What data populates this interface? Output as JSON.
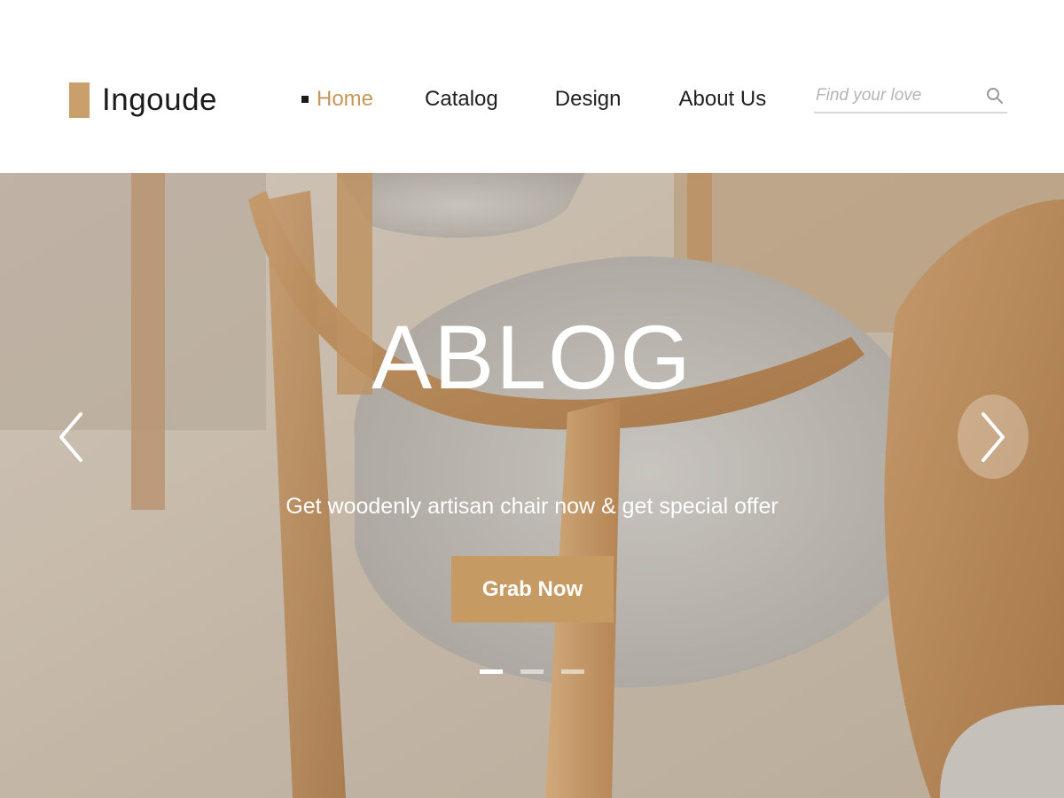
{
  "brand": {
    "name": "Ingoude",
    "accent_color": "#c69a63"
  },
  "nav": {
    "items": [
      {
        "label": "Home",
        "active": true
      },
      {
        "label": "Catalog",
        "active": false
      },
      {
        "label": "Design",
        "active": false
      },
      {
        "label": "About Us",
        "active": false
      }
    ]
  },
  "search": {
    "placeholder": "Find your love",
    "value": "",
    "icon": "search-icon"
  },
  "hero": {
    "title": "ABLOG",
    "subtitle": "Get woodenly artisan chair now & get special offer",
    "cta_label": "Grab Now",
    "prev_icon": "chevron-left-icon",
    "next_icon": "chevron-right-icon",
    "slides_total": 3,
    "active_slide": 1
  }
}
